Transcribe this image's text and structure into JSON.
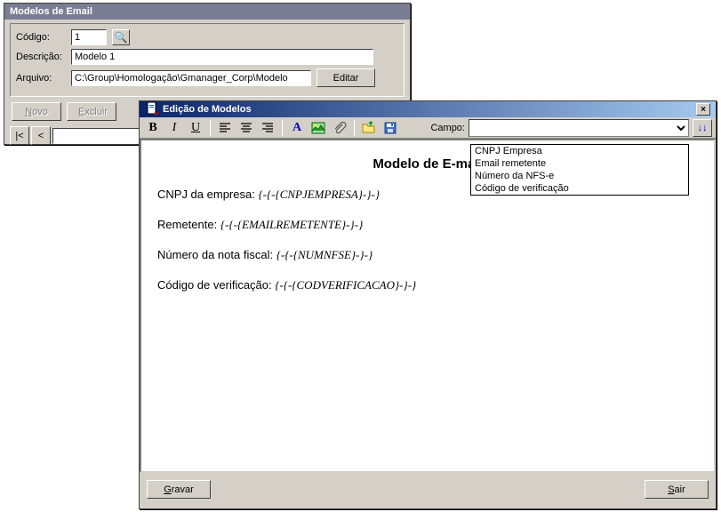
{
  "back_window": {
    "title": "Modelos de Email",
    "labels": {
      "codigo": "Código:",
      "descricao": "Descrição:",
      "arquivo": "Arquivo:"
    },
    "values": {
      "codigo": "1",
      "descricao": "Modelo 1",
      "arquivo": "C:\\Group\\Homologação\\Gmanager_Corp\\Modelo"
    },
    "buttons": {
      "editar": "Editar",
      "novo_pre": "N",
      "novo_post": "ovo",
      "excluir_pre": "E",
      "excluir_post": "xcluir"
    },
    "nav": {
      "first": "|<",
      "prev": "<"
    }
  },
  "front_window": {
    "title": "Edição de Modelos",
    "campo_label": "Campo:",
    "campo_value": "",
    "dropdown_options": [
      "CNPJ Empresa",
      "Email remetente",
      "Número da NFS-e",
      "Código de verificação"
    ],
    "insert_glyph": "↓↓",
    "editor": {
      "heading": "Modelo de E-mail",
      "line1_label": "CNPJ da empresa: ",
      "line1_token": "{-{-{CNPJEMPRESA}-}-}",
      "line2_label": "Remetente: ",
      "line2_token": "{-{-{EMAILREMETENTE}-}-}",
      "line3_label": "Número da nota fiscal: ",
      "line3_token": "{-{-{NUMNFSE}-}-}",
      "line4_label": "Código de verificação: ",
      "line4_token": "{-{-{CODVERIFICACAO}-}-}"
    },
    "buttons": {
      "gravar_pre": "G",
      "gravar_post": "ravar",
      "sair_pre": "S",
      "sair_post": "air"
    },
    "close_glyph": "×"
  }
}
